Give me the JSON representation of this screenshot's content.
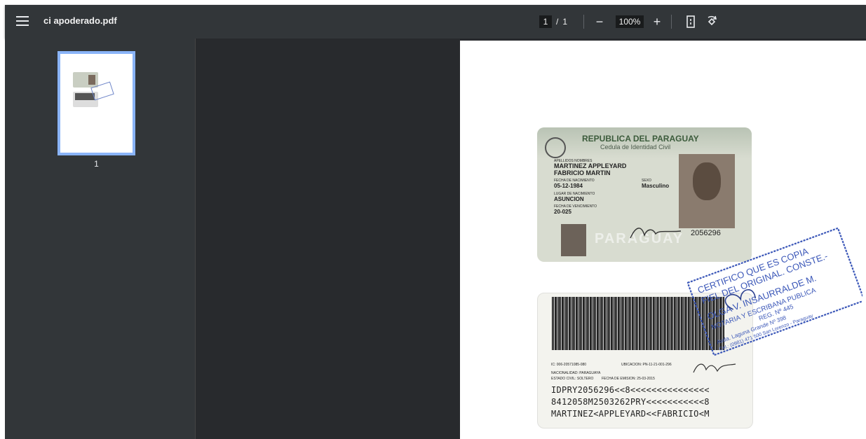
{
  "toolbar": {
    "title": "ci apoderado.pdf",
    "page_current": "1",
    "page_separator": "/",
    "page_total": "1",
    "zoom_out_label": "−",
    "zoom_value": "100%",
    "zoom_in_label": "+",
    "icons": {
      "menu": "hamburger-menu-icon",
      "fit": "fit-to-page-icon",
      "rotate": "rotate-icon"
    }
  },
  "sidebar": {
    "thumbnails": [
      {
        "label": "1"
      }
    ]
  },
  "document": {
    "front": {
      "country": "REPUBLICA DEL PARAGUAY",
      "doc_type": "Cedula de Identidad Civil",
      "names_label": "APELLIDOS NOMBRES",
      "surname": "MARTINEZ APPLEYARD",
      "given": "FABRICIO MARTIN",
      "dob_label": "FECHA DE NACIMIENTO",
      "dob": "05-12-1984",
      "sex_label": "SEXO",
      "sex": "Masculino",
      "pob_label": "LUGAR DE NACIMIENTO",
      "pob": "ASUNCION",
      "exp_label": "FECHA DE VENCIMIENTO",
      "exp": "20-025",
      "number": "2056296",
      "watermark": "PARAGUAY"
    },
    "back": {
      "ic": "IC: 006-20571085-080",
      "location": "UBICACION: PN-11-21-001-296",
      "nationality": "NACIONALIDAD: PARAGUAYA",
      "civil_status": "ESTADO CIVIL: SOLTERO",
      "issue": "FECHA DE EMISION: 25-03-2015",
      "mrz": [
        "IDPRY2056296<<8<<<<<<<<<<<<<<<",
        "8412058M2503262PRY<<<<<<<<<<<8",
        "MARTINEZ<APPLEYARD<<FABRICIO<M"
      ]
    },
    "stamp": {
      "line1": "CERTIFICO QUE ES COPIA",
      "line2": "FIEL DEL ORIGINAL. CONSTE.-",
      "line3": "OLGA V. INSAURRALDE M.",
      "line4": "NOTARIA Y ESCRIBANA PUBLICA",
      "line5": "REG. Nº 445",
      "line6": "Avda. Laguna Grande Nº 398",
      "line7": "Cel.: (0981) 471 500 San Lorenzo - Paraguay"
    }
  }
}
